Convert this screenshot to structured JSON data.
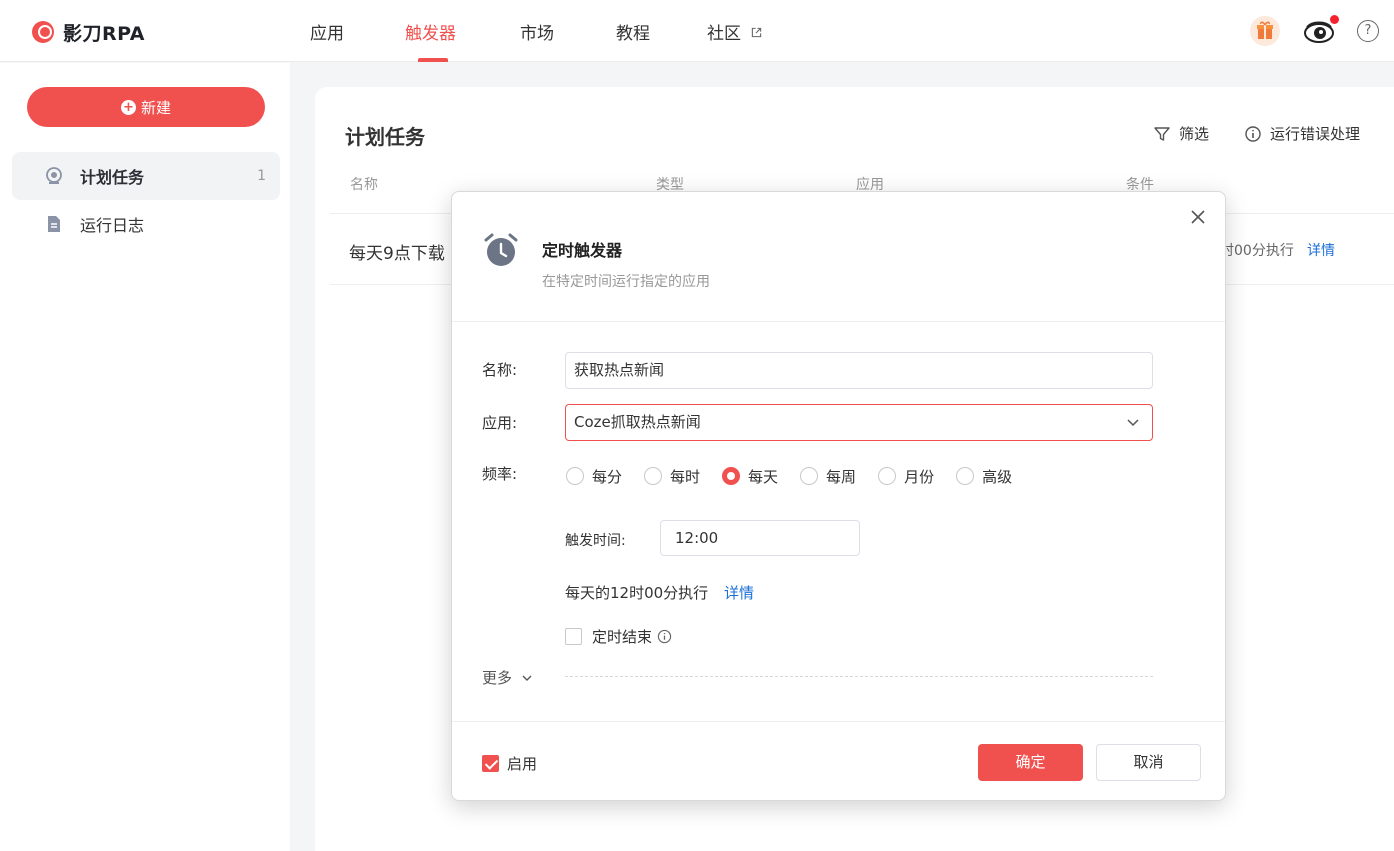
{
  "brand": {
    "name": "影刀RPA"
  },
  "nav": {
    "items": [
      {
        "label": "应用"
      },
      {
        "label": "触发器"
      },
      {
        "label": "市场"
      },
      {
        "label": "教程"
      },
      {
        "label": "社区"
      }
    ],
    "active_index": 1,
    "help_glyph": "?"
  },
  "sidebar": {
    "new_button_label": "新建",
    "items": [
      {
        "label": "计划任务",
        "count": "1",
        "icon": "schedule-icon"
      },
      {
        "label": "运行日志",
        "icon": "document-icon"
      }
    ]
  },
  "main": {
    "title": "计划任务",
    "toolbar": {
      "filter_label": "筛选",
      "error_label": "运行错误处理"
    },
    "columns": [
      "名称",
      "类型",
      "应用",
      "条件"
    ],
    "row": {
      "name": "每天9点下载",
      "condition": "时00分执行",
      "detail_label": "详情"
    }
  },
  "modal": {
    "title": "定时触发器",
    "subtitle": "在特定时间运行指定的应用",
    "name_label": "名称:",
    "name_value": "获取热点新闻",
    "app_label": "应用:",
    "app_value": "Coze抓取热点新闻",
    "freq_label": "频率:",
    "freq_options": [
      "每分",
      "每时",
      "每天",
      "每周",
      "月份",
      "高级"
    ],
    "freq_selected": "每天",
    "trigger_time_label": "触发时间:",
    "trigger_time_value": "12:00",
    "summary": "每天的12时00分执行",
    "summary_link": "详情",
    "end_label": "定时结束",
    "more_label": "更多",
    "enable_label": "启用",
    "enabled": true,
    "ok_label": "确定",
    "cancel_label": "取消"
  },
  "colors": {
    "accent": "#f0514f",
    "link": "#1b6fd4"
  }
}
